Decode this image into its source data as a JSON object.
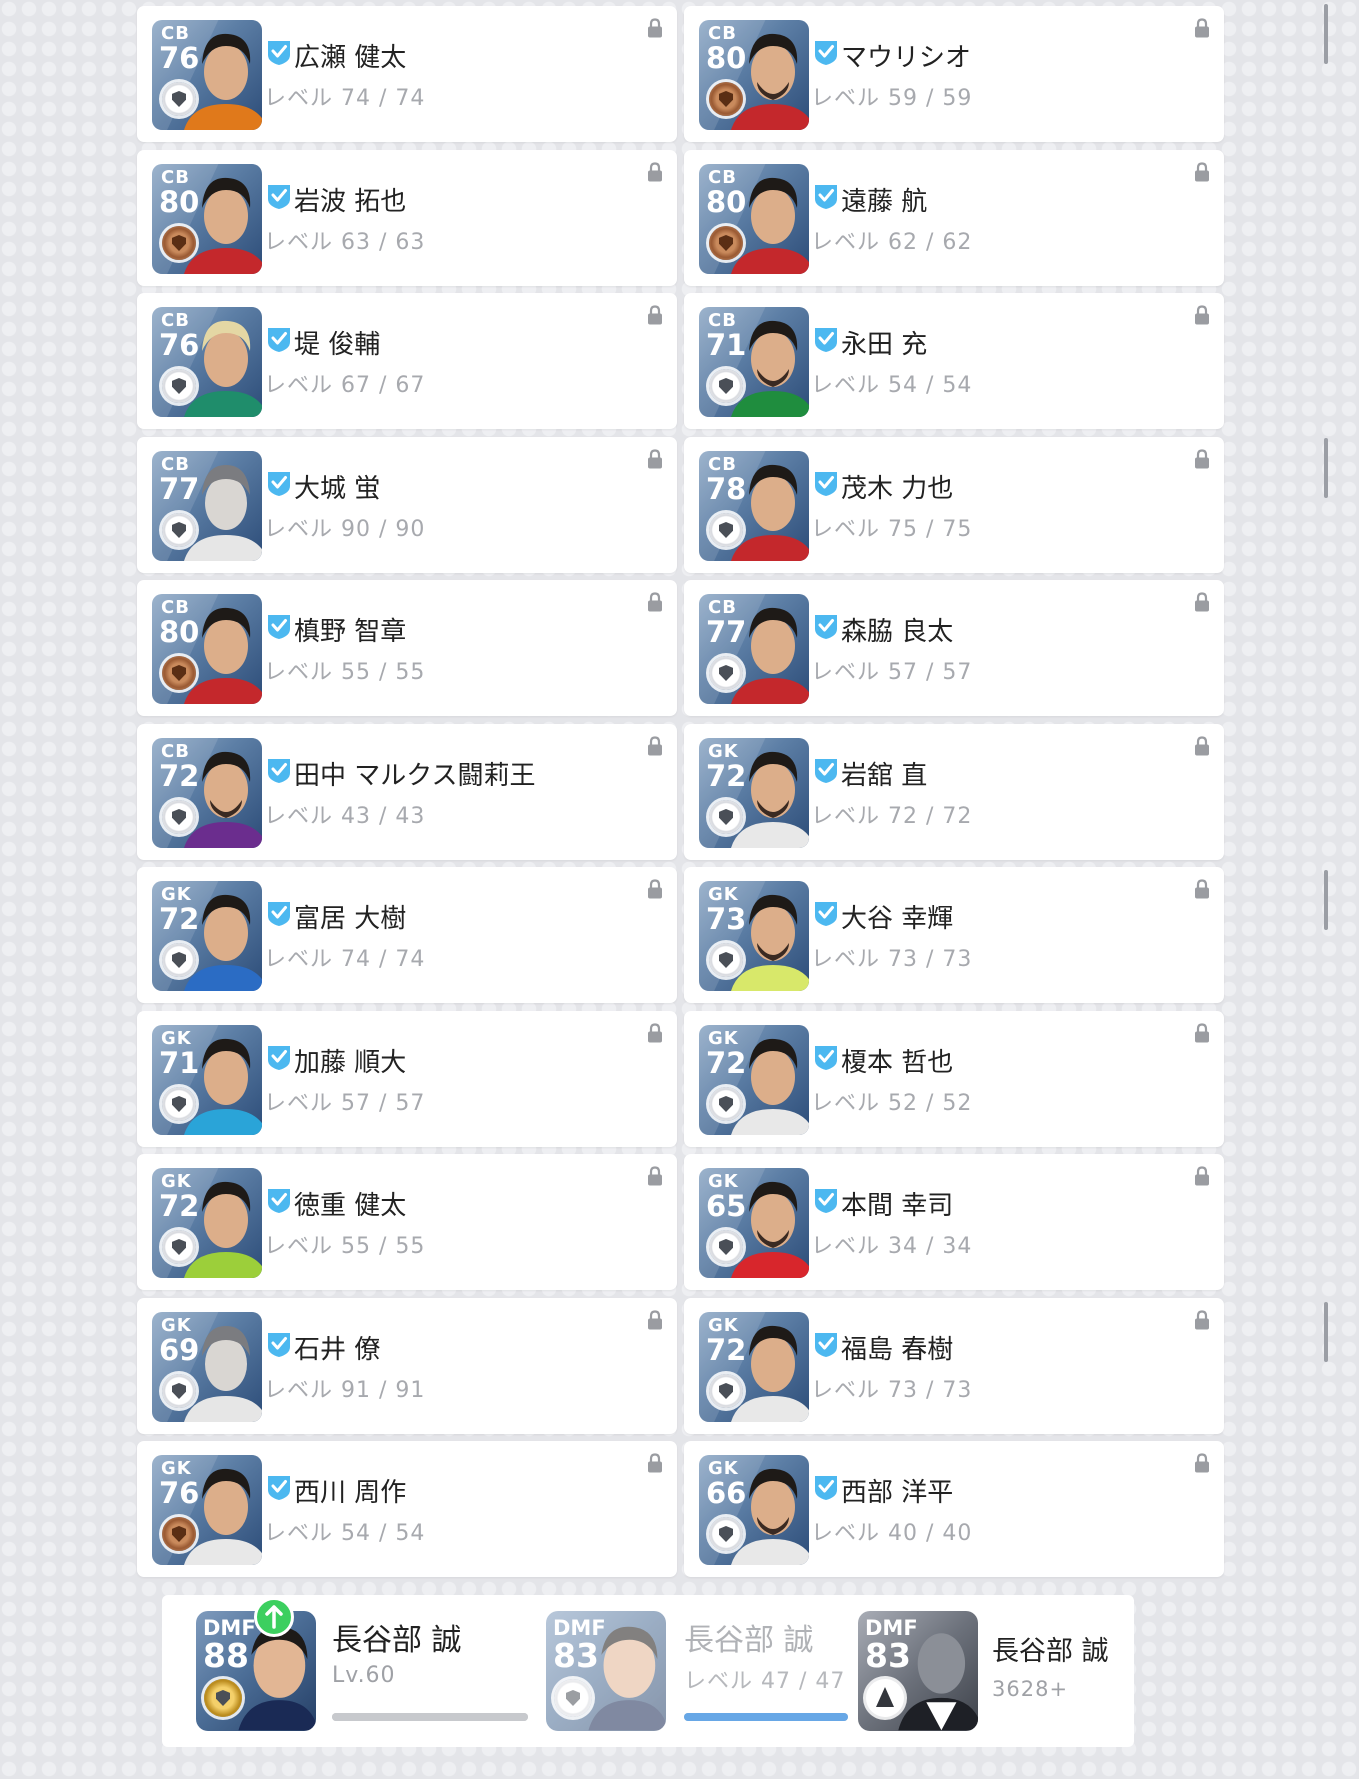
{
  "players": [
    {
      "pos": "CB",
      "rating": "76",
      "name": "広瀬 健太",
      "level": "レベル 74 / 74",
      "medal": "white",
      "photo": "hair-dark",
      "jersey": "#e0791b"
    },
    {
      "pos": "CB",
      "rating": "80",
      "name": "マウリシオ",
      "level": "レベル 59 / 59",
      "medal": "bronze",
      "photo": "beard",
      "jersey": "#c4282c"
    },
    {
      "pos": "CB",
      "rating": "80",
      "name": "岩波 拓也",
      "level": "レベル 63 / 63",
      "medal": "bronze",
      "photo": "hair-dark",
      "jersey": "#c4282c"
    },
    {
      "pos": "CB",
      "rating": "80",
      "name": "遠藤 航",
      "level": "レベル 62 / 62",
      "medal": "bronze",
      "photo": "hair-dark",
      "jersey": "#c4282c"
    },
    {
      "pos": "CB",
      "rating": "76",
      "name": "堤 俊輔",
      "level": "レベル 67 / 67",
      "medal": "white",
      "photo": "hair-blond",
      "jersey": "#1f8d6b"
    },
    {
      "pos": "CB",
      "rating": "71",
      "name": "永田 充",
      "level": "レベル 54 / 54",
      "medal": "white",
      "photo": "beard",
      "jersey": "#1f8d3e"
    },
    {
      "pos": "CB",
      "rating": "77",
      "name": "大城 蛍",
      "level": "レベル 90 / 90",
      "medal": "white",
      "photo": "silhouette",
      "jersey": "#d9d9d9"
    },
    {
      "pos": "CB",
      "rating": "78",
      "name": "茂木 力也",
      "level": "レベル 75 / 75",
      "medal": "white",
      "photo": "hair-dark",
      "jersey": "#c4282c"
    },
    {
      "pos": "CB",
      "rating": "80",
      "name": "槙野 智章",
      "level": "レベル 55 / 55",
      "medal": "bronze",
      "photo": "hair-dark",
      "jersey": "#c4282c"
    },
    {
      "pos": "CB",
      "rating": "77",
      "name": "森脇 良太",
      "level": "レベル 57 / 57",
      "medal": "white",
      "photo": "hair-dark",
      "jersey": "#c4282c"
    },
    {
      "pos": "CB",
      "rating": "72",
      "name": "田中 マルクス闘莉王",
      "level": "レベル 43 / 43",
      "medal": "white",
      "photo": "beard",
      "jersey": "#6b2d8e"
    },
    {
      "pos": "GK",
      "rating": "72",
      "name": "岩舘 直",
      "level": "レベル 72 / 72",
      "medal": "white",
      "photo": "beard",
      "jersey": "#e8e8e8"
    },
    {
      "pos": "GK",
      "rating": "72",
      "name": "富居 大樹",
      "level": "レベル 74 / 74",
      "medal": "white",
      "photo": "hair-dark",
      "jersey": "#2b6cc4"
    },
    {
      "pos": "GK",
      "rating": "73",
      "name": "大谷 幸輝",
      "level": "レベル 73 / 73",
      "medal": "white",
      "photo": "beard",
      "jersey": "#d8e86a"
    },
    {
      "pos": "GK",
      "rating": "71",
      "name": "加藤 順大",
      "level": "レベル 57 / 57",
      "medal": "white",
      "photo": "hair-dark",
      "jersey": "#2aa4d8"
    },
    {
      "pos": "GK",
      "rating": "72",
      "name": "榎本 哲也",
      "level": "レベル 52 / 52",
      "medal": "white",
      "photo": "hair-dark",
      "jersey": "#e8e8e8"
    },
    {
      "pos": "GK",
      "rating": "72",
      "name": "徳重 健太",
      "level": "レベル 55 / 55",
      "medal": "white",
      "photo": "hair-dark",
      "jersey": "#9ccf3a"
    },
    {
      "pos": "GK",
      "rating": "65",
      "name": "本間 幸司",
      "level": "レベル 34 / 34",
      "medal": "white",
      "photo": "beard",
      "jersey": "#d8262c"
    },
    {
      "pos": "GK",
      "rating": "69",
      "name": "石井 僚",
      "level": "レベル 91 / 91",
      "medal": "white",
      "photo": "silhouette",
      "jersey": "#d9d9d9"
    },
    {
      "pos": "GK",
      "rating": "72",
      "name": "福島 春樹",
      "level": "レベル 73 / 73",
      "medal": "white",
      "photo": "hair-dark",
      "jersey": "#e8e8e8"
    },
    {
      "pos": "GK",
      "rating": "76",
      "name": "西川 周作",
      "level": "レベル 54 / 54",
      "medal": "bronze",
      "photo": "hair-dark",
      "jersey": "#e8e8e8"
    },
    {
      "pos": "GK",
      "rating": "66",
      "name": "西部 洋平",
      "level": "レベル 40 / 40",
      "medal": "white",
      "photo": "beard",
      "jersey": "#e8e8e8"
    }
  ],
  "compare": {
    "current": {
      "pos": "DMF",
      "rating": "88",
      "name": "長谷部 誠",
      "sub": "Lv.60",
      "medal": "gold",
      "progress": 1.0,
      "bar_color": "#c7c9cd"
    },
    "candidate": {
      "pos": "DMF",
      "rating": "83",
      "name": "長谷部 誠",
      "sub": "レベル 47 / 47",
      "medal": "white",
      "progress": 1.0,
      "bar_color": "#67a7e6"
    },
    "other": {
      "pos": "DMF",
      "rating": "83",
      "name": "長谷部 誠",
      "sub": "3628+"
    }
  },
  "icons": {
    "verified": "check-badge-icon",
    "lock": "lock-icon",
    "upgrade": "arrow-up-icon"
  },
  "colors": {
    "verified": "#4cb8f0",
    "upgrade": "#3ccf5f"
  }
}
